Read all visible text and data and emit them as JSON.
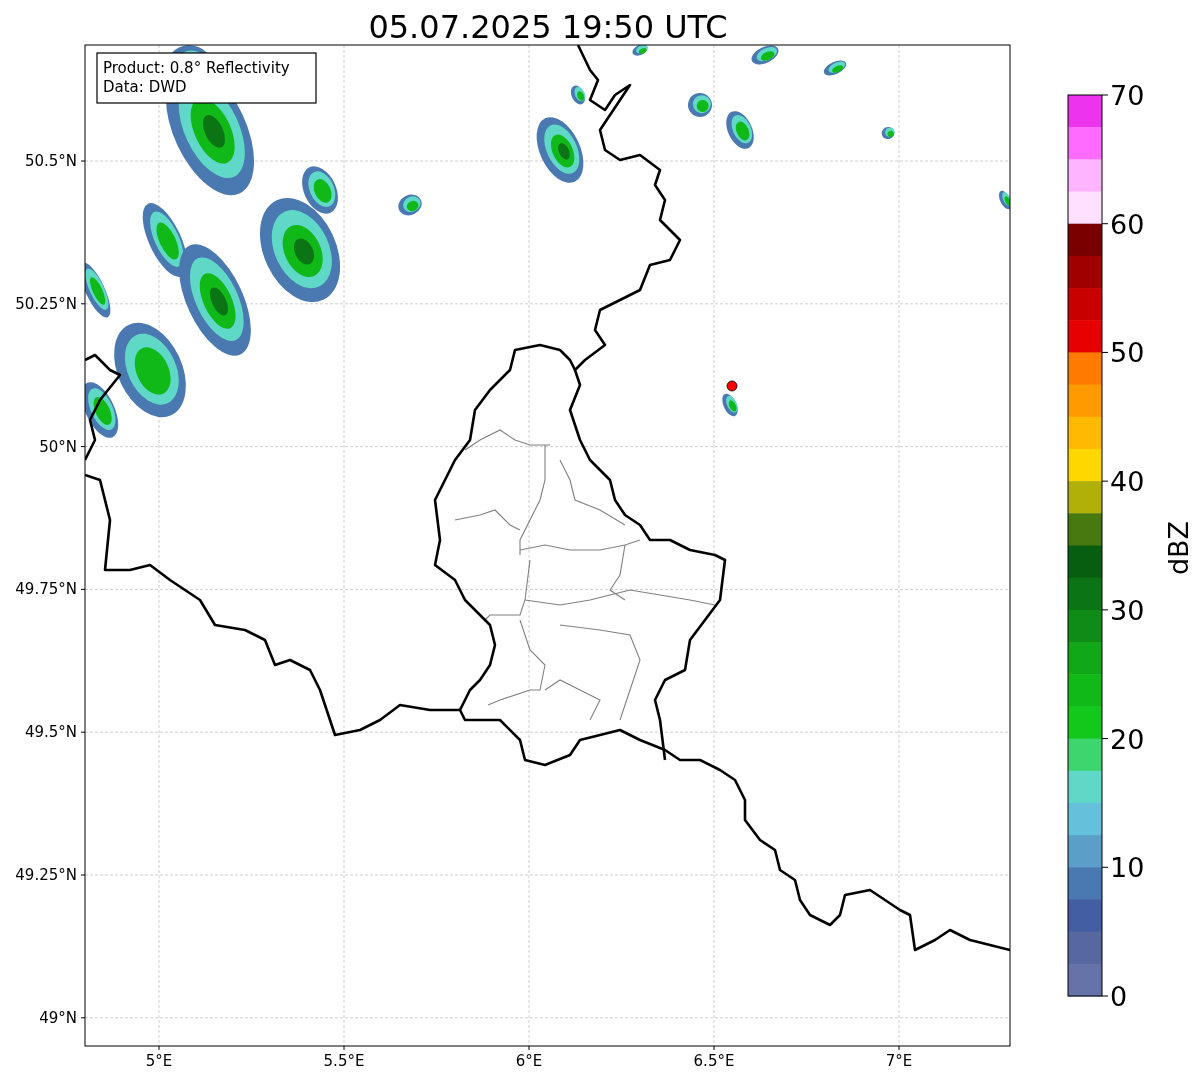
{
  "title": "05.07.2025 19:50 UTC",
  "map": {
    "info_box": [
      "Product: 0.8° Reflectivity",
      "Data: DWD"
    ],
    "x_tick_labels": [
      "5°E",
      "5.5°E",
      "6°E",
      "6.5°E",
      "7°E"
    ],
    "y_tick_labels": [
      "50.5°N",
      "50.25°N",
      "50°N",
      "49.75°N",
      "49.5°N",
      "49.25°N",
      "49°N"
    ]
  },
  "colorbar": {
    "label": "dBZ",
    "tick_labels": [
      "70",
      "60",
      "50",
      "40",
      "30",
      "20",
      "10",
      "0"
    ],
    "bins": [
      {
        "color": "#ee33ee"
      },
      {
        "color": "#ff6aff"
      },
      {
        "color": "#ffb4ff"
      },
      {
        "color": "#ffe0ff"
      },
      {
        "color": "#7a0000"
      },
      {
        "color": "#a00000"
      },
      {
        "color": "#c80000"
      },
      {
        "color": "#e60000"
      },
      {
        "color": "#ff7b00"
      },
      {
        "color": "#ff9a00"
      },
      {
        "color": "#ffb900"
      },
      {
        "color": "#ffd700"
      },
      {
        "color": "#b0b008"
      },
      {
        "color": "#487810"
      },
      {
        "color": "#085e10"
      },
      {
        "color": "#0b7414"
      },
      {
        "color": "#0f8c18"
      },
      {
        "color": "#10a818"
      },
      {
        "color": "#10b818"
      },
      {
        "color": "#12c81a"
      },
      {
        "color": "#3dd66e"
      },
      {
        "color": "#60d8c8"
      },
      {
        "color": "#65c0dc"
      },
      {
        "color": "#5b9ec8"
      },
      {
        "color": "#4a78b0"
      },
      {
        "color": "#445ea3"
      },
      {
        "color": "#5768a0"
      },
      {
        "color": "#6673a8"
      }
    ]
  }
}
